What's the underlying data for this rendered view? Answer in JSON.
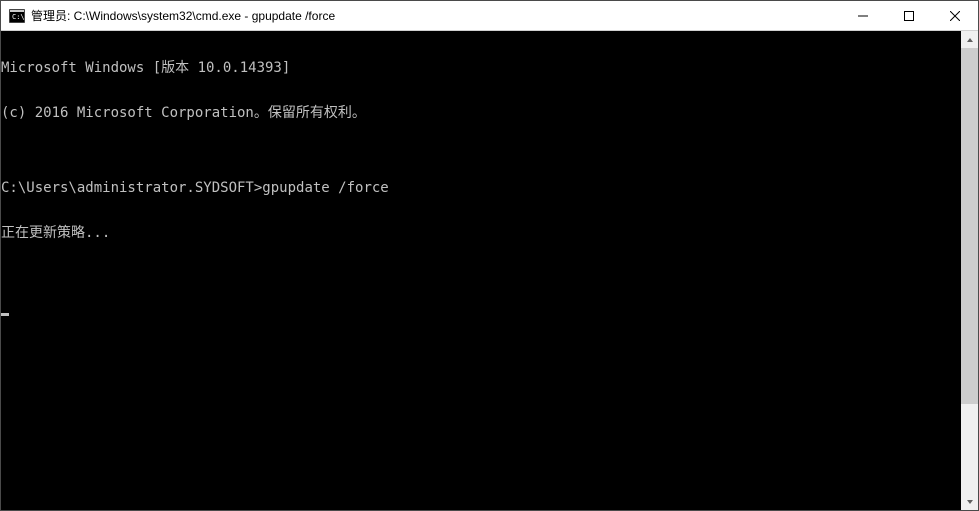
{
  "window": {
    "title": "管理员: C:\\Windows\\system32\\cmd.exe - gpupdate  /force"
  },
  "terminal": {
    "line1": "Microsoft Windows [版本 10.0.14393]",
    "line2": "(c) 2016 Microsoft Corporation。保留所有权利。",
    "line3": "",
    "prompt": "C:\\Users\\administrator.SYDSOFT>",
    "command": "gpupdate /force",
    "line5": "正在更新策略...",
    "line6": ""
  }
}
